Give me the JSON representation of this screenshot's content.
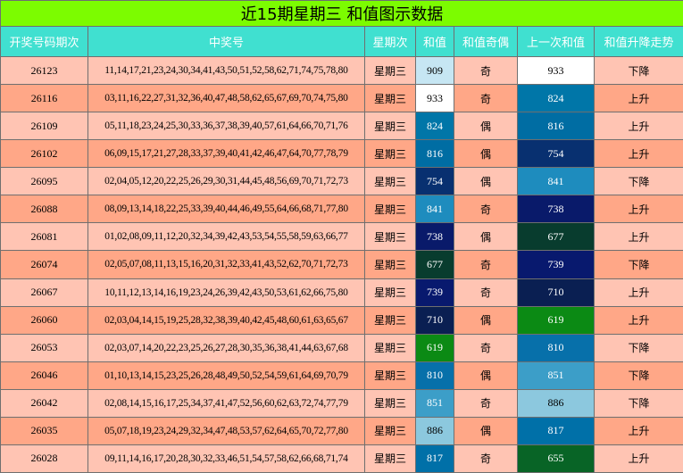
{
  "title": "近15期星期三 和值图示数据",
  "headers": [
    "开奖号码期次",
    "中奖号",
    "星期次",
    "和值",
    "和值奇偶",
    "上一次和值",
    "和值升降走势"
  ],
  "rows": [
    {
      "period": "26123",
      "numbers": "11,14,17,21,23,24,30,34,41,43,50,51,52,58,62,71,74,75,78,80",
      "weekday": "星期三",
      "sum": "909",
      "parity": "奇",
      "prev": "933",
      "trend": "下降"
    },
    {
      "period": "26116",
      "numbers": "03,11,16,22,27,31,32,36,40,47,48,58,62,65,67,69,70,74,75,80",
      "weekday": "星期三",
      "sum": "933",
      "parity": "奇",
      "prev": "824",
      "trend": "上升"
    },
    {
      "period": "26109",
      "numbers": "05,11,18,23,24,25,30,33,36,37,38,39,40,57,61,64,66,70,71,76",
      "weekday": "星期三",
      "sum": "824",
      "parity": "偶",
      "prev": "816",
      "trend": "上升"
    },
    {
      "period": "26102",
      "numbers": "06,09,15,17,21,27,28,33,37,39,40,41,42,46,47,64,70,77,78,79",
      "weekday": "星期三",
      "sum": "816",
      "parity": "偶",
      "prev": "754",
      "trend": "上升"
    },
    {
      "period": "26095",
      "numbers": "02,04,05,12,20,22,25,26,29,30,31,44,45,48,56,69,70,71,72,73",
      "weekday": "星期三",
      "sum": "754",
      "parity": "偶",
      "prev": "841",
      "trend": "下降"
    },
    {
      "period": "26088",
      "numbers": "08,09,13,14,18,22,25,33,39,40,44,46,49,55,64,66,68,71,77,80",
      "weekday": "星期三",
      "sum": "841",
      "parity": "奇",
      "prev": "738",
      "trend": "上升"
    },
    {
      "period": "26081",
      "numbers": "01,02,08,09,11,12,20,32,34,39,42,43,53,54,55,58,59,63,66,77",
      "weekday": "星期三",
      "sum": "738",
      "parity": "偶",
      "prev": "677",
      "trend": "上升"
    },
    {
      "period": "26074",
      "numbers": "02,05,07,08,11,13,15,16,20,31,32,33,41,43,52,62,70,71,72,73",
      "weekday": "星期三",
      "sum": "677",
      "parity": "奇",
      "prev": "739",
      "trend": "下降"
    },
    {
      "period": "26067",
      "numbers": "10,11,12,13,14,16,19,23,24,26,39,42,43,50,53,61,62,66,75,80",
      "weekday": "星期三",
      "sum": "739",
      "parity": "奇",
      "prev": "710",
      "trend": "上升"
    },
    {
      "period": "26060",
      "numbers": "02,03,04,14,15,19,25,28,32,38,39,40,42,45,48,60,61,63,65,67",
      "weekday": "星期三",
      "sum": "710",
      "parity": "偶",
      "prev": "619",
      "trend": "上升"
    },
    {
      "period": "26053",
      "numbers": "02,03,07,14,20,22,23,25,26,27,28,30,35,36,38,41,44,63,67,68",
      "weekday": "星期三",
      "sum": "619",
      "parity": "奇",
      "prev": "810",
      "trend": "下降"
    },
    {
      "period": "26046",
      "numbers": "01,10,13,14,15,23,25,26,28,48,49,50,52,54,59,61,64,69,70,79",
      "weekday": "星期三",
      "sum": "810",
      "parity": "偶",
      "prev": "851",
      "trend": "下降"
    },
    {
      "period": "26042",
      "numbers": "02,08,14,15,16,17,25,34,37,41,47,52,56,60,62,63,72,74,77,79",
      "weekday": "星期三",
      "sum": "851",
      "parity": "奇",
      "prev": "886",
      "trend": "下降"
    },
    {
      "period": "26035",
      "numbers": "05,07,18,19,23,24,29,32,34,47,48,53,57,62,64,65,70,72,77,80",
      "weekday": "星期三",
      "sum": "886",
      "parity": "偶",
      "prev": "817",
      "trend": "上升"
    },
    {
      "period": "26028",
      "numbers": "09,11,14,16,17,20,28,30,32,33,46,51,54,57,58,62,66,68,71,74",
      "weekday": "星期三",
      "sum": "817",
      "parity": "奇",
      "prev": "655",
      "trend": "上升"
    }
  ],
  "value_colors": {
    "909": {
      "bg": "#c6e6f3",
      "fg": "#000000"
    },
    "933": {
      "bg": "#ffffff",
      "fg": "#000000"
    },
    "824": {
      "bg": "#0076a8",
      "fg": "#ffffff"
    },
    "816": {
      "bg": "#006da3",
      "fg": "#ffffff"
    },
    "754": {
      "bg": "#083070",
      "fg": "#ffffff"
    },
    "841": {
      "bg": "#1e8cbe",
      "fg": "#ffffff"
    },
    "738": {
      "bg": "#091a6a",
      "fg": "#ffffff"
    },
    "677": {
      "bg": "#083c2e",
      "fg": "#ffffff"
    },
    "739": {
      "bg": "#08196e",
      "fg": "#ffffff"
    },
    "710": {
      "bg": "#0a1f52",
      "fg": "#ffffff"
    },
    "619": {
      "bg": "#0b8a14",
      "fg": "#ffffff"
    },
    "810": {
      "bg": "#0770aa",
      "fg": "#ffffff"
    },
    "851": {
      "bg": "#3c9ec8",
      "fg": "#ffffff"
    },
    "886": {
      "bg": "#8cc8de",
      "fg": "#000000"
    },
    "817": {
      "bg": "#0070a8",
      "fg": "#ffffff"
    },
    "655": {
      "bg": "#086426",
      "fg": "#ffffff"
    }
  },
  "colors": {
    "title_bg": "#7cfc00",
    "header_bg": "#40e0d0",
    "row_light": "#ffc4b3",
    "row_dark": "#ffa787"
  }
}
